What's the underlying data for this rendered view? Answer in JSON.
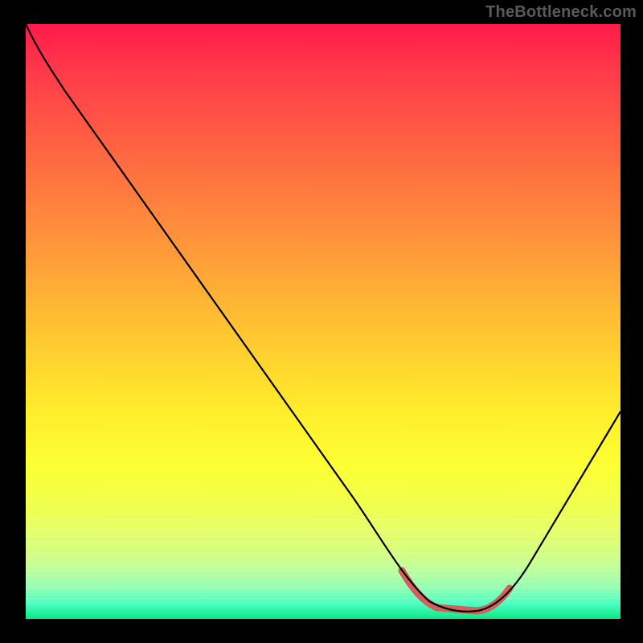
{
  "watermark": "TheBottleneck.com",
  "colors": {
    "background": "#000000",
    "curve": "#000000",
    "highlight": "#d4605c",
    "watermark_text": "#5a5a5a"
  },
  "chart_data": {
    "type": "line",
    "title": "",
    "xlabel": "",
    "ylabel": "",
    "xlim": [
      0,
      100
    ],
    "ylim": [
      0,
      100
    ],
    "grid": false,
    "x": [
      0,
      5,
      10,
      15,
      20,
      25,
      30,
      35,
      40,
      45,
      50,
      55,
      60,
      65,
      68,
      72,
      76,
      80,
      84,
      88,
      92,
      96,
      100
    ],
    "values": [
      100,
      96,
      91,
      85,
      79,
      72,
      65,
      58,
      51,
      44,
      37,
      29,
      21,
      12,
      6,
      2,
      1,
      1,
      2,
      8,
      17,
      26,
      35
    ],
    "highlight_range_x": [
      63,
      82
    ],
    "note": "Values estimated from pixel positions; curve is a bottleneck V-shape reaching minimum near x≈72–78."
  }
}
